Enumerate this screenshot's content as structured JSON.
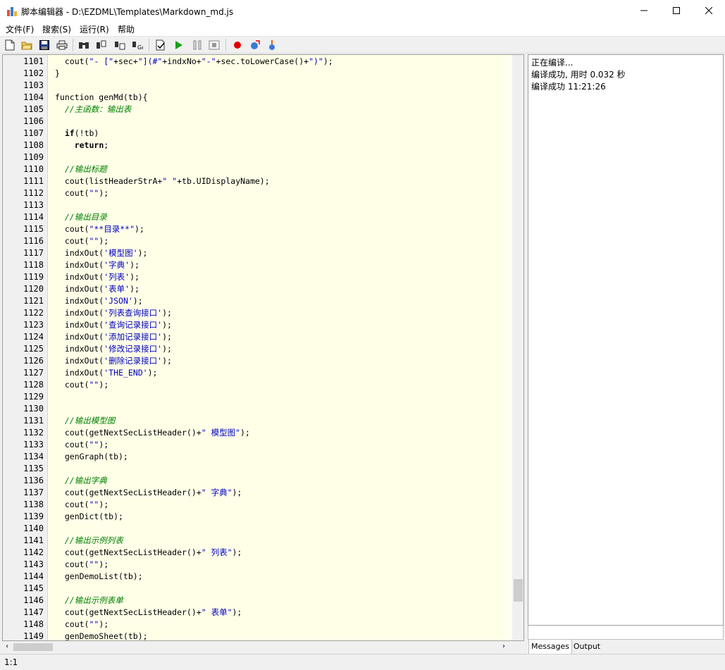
{
  "window": {
    "title": "脚本编辑器 - D:\\EZDML\\Templates\\Markdown_md.js",
    "minimize_icon": "minimize-icon",
    "maximize_icon": "maximize-icon",
    "close_icon": "close-icon"
  },
  "menu": [
    "文件(F)",
    "搜索(S)",
    "运行(R)",
    "帮助"
  ],
  "toolbar": {
    "buttons": [
      "new-file-icon",
      "open-folder-icon",
      "save-icon",
      "print-icon",
      "find-icon",
      "find-next-icon",
      "replace-icon",
      "goto-icon",
      "compile-icon",
      "run-icon",
      "pause-icon",
      "stop-icon",
      "breakpoint-icon",
      "step-into-icon",
      "step-over-icon"
    ]
  },
  "colors": {
    "editor_bg": "#ffffe8",
    "string": "#0000c0",
    "comment": "#008000",
    "keyword": "#000000"
  },
  "editor": {
    "lines": [
      {
        "n": "1101",
        "segs": [
          {
            "t": "  cout(",
            "c": "n"
          },
          {
            "t": "\"- [\"",
            "c": "s"
          },
          {
            "t": "+sec+",
            "c": "n"
          },
          {
            "t": "\"](#\"",
            "c": "s"
          },
          {
            "t": "+indxNo+",
            "c": "n"
          },
          {
            "t": "\"-\"",
            "c": "s"
          },
          {
            "t": "+sec.toLowerCase()+",
            "c": "n"
          },
          {
            "t": "\")\"",
            "c": "s"
          },
          {
            "t": ");",
            "c": "n"
          }
        ]
      },
      {
        "n": "1102",
        "segs": [
          {
            "t": "}",
            "c": "n"
          }
        ]
      },
      {
        "n": "1103",
        "segs": []
      },
      {
        "n": "1104",
        "segs": [
          {
            "t": "function genMd(tb){",
            "c": "n"
          }
        ]
      },
      {
        "n": "1105",
        "segs": [
          {
            "t": "  //主函数：输出表",
            "c": "c"
          }
        ]
      },
      {
        "n": "1106",
        "segs": []
      },
      {
        "n": "1107",
        "segs": [
          {
            "t": "  ",
            "c": "n"
          },
          {
            "t": "if",
            "c": "k"
          },
          {
            "t": "(!tb)",
            "c": "n"
          }
        ]
      },
      {
        "n": "1108",
        "segs": [
          {
            "t": "    ",
            "c": "n"
          },
          {
            "t": "return",
            "c": "k"
          },
          {
            "t": ";",
            "c": "n"
          }
        ]
      },
      {
        "n": "1109",
        "segs": []
      },
      {
        "n": "1110",
        "segs": [
          {
            "t": "  //输出标题",
            "c": "c"
          }
        ]
      },
      {
        "n": "1111",
        "segs": [
          {
            "t": "  cout(listHeaderStrA+",
            "c": "n"
          },
          {
            "t": "\" \"",
            "c": "s"
          },
          {
            "t": "+tb.UIDisplayName);",
            "c": "n"
          }
        ]
      },
      {
        "n": "1112",
        "segs": [
          {
            "t": "  cout(",
            "c": "n"
          },
          {
            "t": "\"\"",
            "c": "s"
          },
          {
            "t": ");",
            "c": "n"
          }
        ]
      },
      {
        "n": "1113",
        "segs": []
      },
      {
        "n": "1114",
        "segs": [
          {
            "t": "  //输出目录",
            "c": "c"
          }
        ]
      },
      {
        "n": "1115",
        "segs": [
          {
            "t": "  cout(",
            "c": "n"
          },
          {
            "t": "\"**目录**\"",
            "c": "s"
          },
          {
            "t": ");",
            "c": "n"
          }
        ]
      },
      {
        "n": "1116",
        "segs": [
          {
            "t": "  cout(",
            "c": "n"
          },
          {
            "t": "\"\"",
            "c": "s"
          },
          {
            "t": ");",
            "c": "n"
          }
        ]
      },
      {
        "n": "1117",
        "segs": [
          {
            "t": "  indxOut(",
            "c": "n"
          },
          {
            "t": "'模型图'",
            "c": "s"
          },
          {
            "t": ");",
            "c": "n"
          }
        ]
      },
      {
        "n": "1118",
        "segs": [
          {
            "t": "  indxOut(",
            "c": "n"
          },
          {
            "t": "'字典'",
            "c": "s"
          },
          {
            "t": ");",
            "c": "n"
          }
        ]
      },
      {
        "n": "1119",
        "segs": [
          {
            "t": "  indxOut(",
            "c": "n"
          },
          {
            "t": "'列表'",
            "c": "s"
          },
          {
            "t": ");",
            "c": "n"
          }
        ]
      },
      {
        "n": "1120",
        "segs": [
          {
            "t": "  indxOut(",
            "c": "n"
          },
          {
            "t": "'表单'",
            "c": "s"
          },
          {
            "t": ");",
            "c": "n"
          }
        ]
      },
      {
        "n": "1121",
        "segs": [
          {
            "t": "  indxOut(",
            "c": "n"
          },
          {
            "t": "'JSON'",
            "c": "s"
          },
          {
            "t": ");",
            "c": "n"
          }
        ]
      },
      {
        "n": "1122",
        "segs": [
          {
            "t": "  indxOut(",
            "c": "n"
          },
          {
            "t": "'列表查询接口'",
            "c": "s"
          },
          {
            "t": ");",
            "c": "n"
          }
        ]
      },
      {
        "n": "1123",
        "segs": [
          {
            "t": "  indxOut(",
            "c": "n"
          },
          {
            "t": "'查询记录接口'",
            "c": "s"
          },
          {
            "t": ");",
            "c": "n"
          }
        ]
      },
      {
        "n": "1124",
        "segs": [
          {
            "t": "  indxOut(",
            "c": "n"
          },
          {
            "t": "'添加记录接口'",
            "c": "s"
          },
          {
            "t": ");",
            "c": "n"
          }
        ]
      },
      {
        "n": "1125",
        "segs": [
          {
            "t": "  indxOut(",
            "c": "n"
          },
          {
            "t": "'修改记录接口'",
            "c": "s"
          },
          {
            "t": ");",
            "c": "n"
          }
        ]
      },
      {
        "n": "1126",
        "segs": [
          {
            "t": "  indxOut(",
            "c": "n"
          },
          {
            "t": "'删除记录接口'",
            "c": "s"
          },
          {
            "t": ");",
            "c": "n"
          }
        ]
      },
      {
        "n": "1127",
        "segs": [
          {
            "t": "  indxOut(",
            "c": "n"
          },
          {
            "t": "'THE_END'",
            "c": "s"
          },
          {
            "t": ");",
            "c": "n"
          }
        ]
      },
      {
        "n": "1128",
        "segs": [
          {
            "t": "  cout(",
            "c": "n"
          },
          {
            "t": "\"\"",
            "c": "s"
          },
          {
            "t": ");",
            "c": "n"
          }
        ]
      },
      {
        "n": "1129",
        "segs": []
      },
      {
        "n": "1130",
        "segs": []
      },
      {
        "n": "1131",
        "segs": [
          {
            "t": "  //输出模型图",
            "c": "c"
          }
        ]
      },
      {
        "n": "1132",
        "segs": [
          {
            "t": "  cout(getNextSecListHeader()+",
            "c": "n"
          },
          {
            "t": "\" 模型图\"",
            "c": "s"
          },
          {
            "t": ");",
            "c": "n"
          }
        ]
      },
      {
        "n": "1133",
        "segs": [
          {
            "t": "  cout(",
            "c": "n"
          },
          {
            "t": "\"\"",
            "c": "s"
          },
          {
            "t": ");",
            "c": "n"
          }
        ]
      },
      {
        "n": "1134",
        "segs": [
          {
            "t": "  genGraph(tb);",
            "c": "n"
          }
        ]
      },
      {
        "n": "1135",
        "segs": []
      },
      {
        "n": "1136",
        "segs": [
          {
            "t": "  //输出字典",
            "c": "c"
          }
        ]
      },
      {
        "n": "1137",
        "segs": [
          {
            "t": "  cout(getNextSecListHeader()+",
            "c": "n"
          },
          {
            "t": "\" 字典\"",
            "c": "s"
          },
          {
            "t": ");",
            "c": "n"
          }
        ]
      },
      {
        "n": "1138",
        "segs": [
          {
            "t": "  cout(",
            "c": "n"
          },
          {
            "t": "\"\"",
            "c": "s"
          },
          {
            "t": ");",
            "c": "n"
          }
        ]
      },
      {
        "n": "1139",
        "segs": [
          {
            "t": "  genDict(tb);",
            "c": "n"
          }
        ]
      },
      {
        "n": "1140",
        "segs": []
      },
      {
        "n": "1141",
        "segs": [
          {
            "t": "  //输出示例列表",
            "c": "c"
          }
        ]
      },
      {
        "n": "1142",
        "segs": [
          {
            "t": "  cout(getNextSecListHeader()+",
            "c": "n"
          },
          {
            "t": "\" 列表\"",
            "c": "s"
          },
          {
            "t": ");",
            "c": "n"
          }
        ]
      },
      {
        "n": "1143",
        "segs": [
          {
            "t": "  cout(",
            "c": "n"
          },
          {
            "t": "\"\"",
            "c": "s"
          },
          {
            "t": ");",
            "c": "n"
          }
        ]
      },
      {
        "n": "1144",
        "segs": [
          {
            "t": "  genDemoList(tb);",
            "c": "n"
          }
        ]
      },
      {
        "n": "1145",
        "segs": []
      },
      {
        "n": "1146",
        "segs": [
          {
            "t": "  //输出示例表单",
            "c": "c"
          }
        ]
      },
      {
        "n": "1147",
        "segs": [
          {
            "t": "  cout(getNextSecListHeader()+",
            "c": "n"
          },
          {
            "t": "\" 表单\"",
            "c": "s"
          },
          {
            "t": ");",
            "c": "n"
          }
        ]
      },
      {
        "n": "1148",
        "segs": [
          {
            "t": "  cout(",
            "c": "n"
          },
          {
            "t": "\"\"",
            "c": "s"
          },
          {
            "t": ");",
            "c": "n"
          }
        ]
      },
      {
        "n": "1149",
        "segs": [
          {
            "t": "  genDemoSheet(tb);",
            "c": "n"
          }
        ]
      }
    ]
  },
  "messages": [
    "正在编译...",
    "编译成功, 用时 0.032 秒",
    "编译成功 11:21:26"
  ],
  "tabs": [
    "Messages",
    "Output"
  ],
  "status": {
    "position": "1:1"
  }
}
